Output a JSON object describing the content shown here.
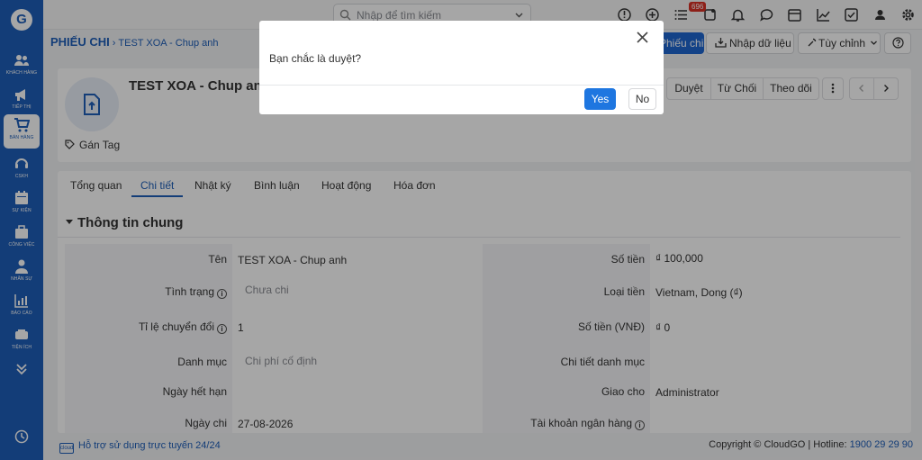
{
  "sidebar": {
    "logo": "G",
    "items": [
      {
        "label": "KHÁCH HÀNG",
        "icon": "users-icon"
      },
      {
        "label": "TIẾP THỊ",
        "icon": "megaphone-icon"
      },
      {
        "label": "BÁN HÀNG",
        "icon": "cart-icon"
      },
      {
        "label": "CSKH",
        "icon": "headset-icon"
      },
      {
        "label": "SỰ KIỆN",
        "icon": "calendar-icon"
      },
      {
        "label": "CÔNG VIỆC",
        "icon": "briefcase-icon"
      },
      {
        "label": "NHÂN SỰ",
        "icon": "person-icon"
      },
      {
        "label": "BÁO CÁO",
        "icon": "report-icon"
      },
      {
        "label": "TIỆN ÍCH",
        "icon": "utility-icon"
      }
    ]
  },
  "topbar": {
    "search_placeholder": "Nhập để tìm kiếm",
    "notification_count": "696"
  },
  "breadcrumb": {
    "module": "PHIẾU CHI",
    "record": "TEST XOA - Chup anh"
  },
  "toolbar": {
    "add_label": "Phiếu chi",
    "import_label": "Nhập dữ liệu",
    "customize_label": "Tùy chỉnh"
  },
  "record": {
    "title": "TEST XOA - Chup anh",
    "tag_label": "Gán Tag",
    "actions": {
      "approve": "Duyệt",
      "reject": "Từ Chối",
      "follow": "Theo dõi"
    }
  },
  "tabs": [
    "Tổng quan",
    "Chi tiết",
    "Nhật ký",
    "Bình luận",
    "Hoạt động",
    "Hóa đơn"
  ],
  "active_tab": "Chi tiết",
  "section": {
    "title": "Thông tin chung",
    "fields_left": [
      {
        "label": "Tên",
        "value": "TEST XOA - Chup anh"
      },
      {
        "label": "Tình trạng",
        "value": "Chưa chi"
      },
      {
        "label": "Tỉ lệ chuyển đổi",
        "value": "1"
      },
      {
        "label": "Danh mục",
        "value": "Chi phí cố định"
      },
      {
        "label": "Ngày hết hạn",
        "value": ""
      },
      {
        "label": "Ngày chi",
        "value": "27-08-2026"
      }
    ],
    "fields_right": [
      {
        "label": "Số tiền",
        "value": "₫ 100,000"
      },
      {
        "label": "Loại tiền",
        "value": "Vietnam, Dong (₫)"
      },
      {
        "label": "Số tiền (VNĐ)",
        "value": "₫ 0"
      },
      {
        "label": "Chi tiết danh mục",
        "value": ""
      },
      {
        "label": "Giao cho",
        "value": "Administrator"
      },
      {
        "label": "Tài khoản ngân hàng",
        "value": ""
      }
    ]
  },
  "footer": {
    "support": "Hỗ trợ sử dụng trực tuyến 24/24",
    "copyright": "Copyright © CloudGO | Hotline:",
    "hotline": "1900 29 29 90"
  },
  "modal": {
    "message": "Bạn chắc là duyệt?",
    "yes_label": "Yes",
    "no_label": "No"
  },
  "colors": {
    "sidebar": "#1e5eb8",
    "accent": "#1e76e0",
    "overlay": "rgba(0,0,0,0.35)"
  }
}
